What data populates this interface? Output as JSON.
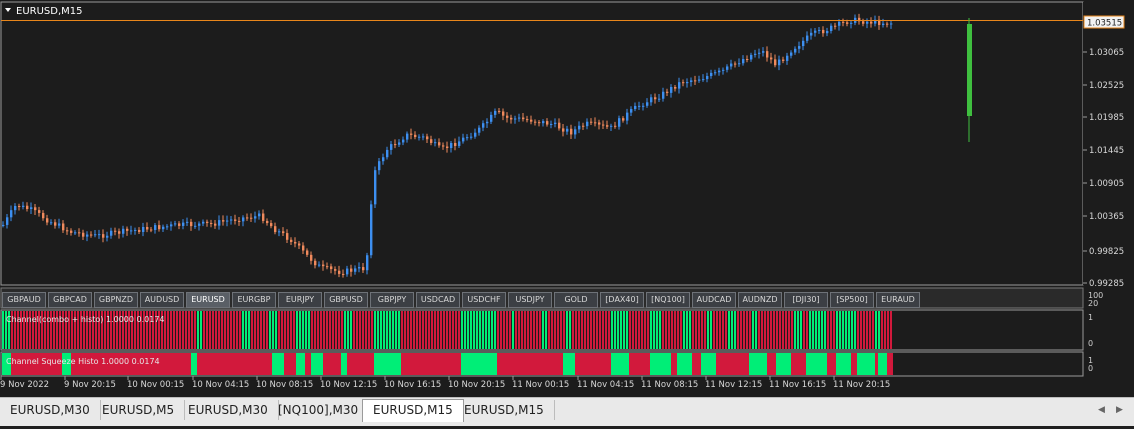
{
  "chart": {
    "title": "EURUSD,M15",
    "current_price": "1.03515",
    "price_ticks": [
      "1.03515",
      "1.03065",
      "1.02525",
      "1.01985",
      "1.01445",
      "1.00905",
      "1.00365",
      "0.99825",
      "0.99285"
    ],
    "time_ticks": [
      "9 Nov 2022",
      "9 Nov 20:15",
      "10 Nov 00:15",
      "10 Nov 04:15",
      "10 Nov 08:15",
      "10 Nov 12:15",
      "10 Nov 16:15",
      "10 Nov 20:15",
      "11 Nov 00:15",
      "11 Nov 04:15",
      "11 Nov 08:15",
      "11 Nov 12:15",
      "11 Nov 16:15",
      "11 Nov 20:15"
    ],
    "colors": {
      "bull": "#3d8ff0",
      "bear": "#f08a5d",
      "bg": "#1c1c1c",
      "border": "#9a9a9a",
      "price_line": "#e8861b",
      "green": "#00ee77",
      "red": "#d2193c",
      "signal": "#3fbf3f"
    }
  },
  "symbols": [
    "GBPAUD",
    "GBPCAD",
    "GBPNZD",
    "AUDUSD",
    "EURUSD",
    "EURGBP",
    "EURJPY",
    "GBPUSD",
    "GBPJPY",
    "USDCAD",
    "USDCHF",
    "USDJPY",
    "GOLD",
    "[DAX40]",
    "[NQ100]",
    "AUDCAD",
    "AUDNZD",
    "[DJI30]",
    "[SP500]",
    "EURAUD"
  ],
  "selected_symbol": "EURUSD",
  "scale_labels": {
    "top": "100",
    "bottom": "20"
  },
  "indicator1": {
    "label": "Channel(combo + histo) 1.0000 0.0174",
    "scale_top": "1",
    "scale_bottom": "0"
  },
  "indicator2": {
    "label": "Channel Squeeze Histo 1.0000 0.0174",
    "scale_top": "1",
    "scale_bottom": "0"
  },
  "tabs": [
    {
      "label": "EURUSD,M30",
      "active": false
    },
    {
      "label": "EURUSD,M5",
      "active": false
    },
    {
      "label": "EURUSD,M30",
      "active": false
    },
    {
      "label": "[NQ100],M30",
      "active": false
    },
    {
      "label": "EURUSD,M15",
      "active": true
    },
    {
      "label": "EURUSD,M15",
      "active": false
    }
  ],
  "scroll_left_icon": "arrow-left-icon",
  "scroll_right_icon": "arrow-right-icon"
}
